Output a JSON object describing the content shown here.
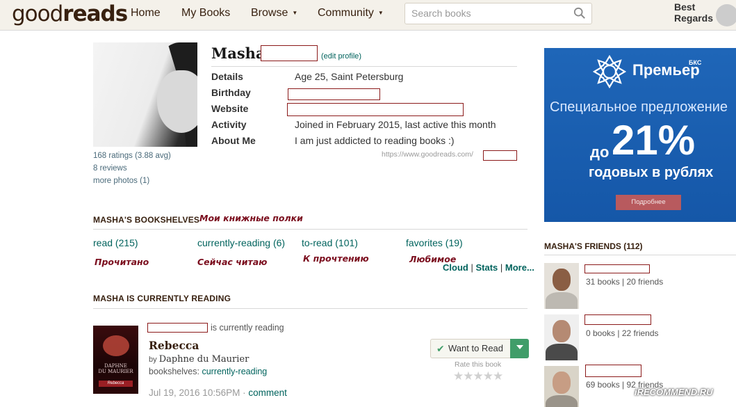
{
  "header": {
    "logo_light": "good",
    "logo_bold": "reads",
    "nav": [
      "Home",
      "My Books",
      "Browse",
      "Community"
    ],
    "search_placeholder": "Search books",
    "greeting": "Best Regards"
  },
  "profile": {
    "name": "Masha",
    "edit_link": "(edit profile)",
    "stats": [
      "168 ratings (3.88 avg)",
      "8 reviews",
      "more photos (1)"
    ],
    "details": [
      {
        "label": "Details",
        "value": "Age 25, Saint Petersburg"
      },
      {
        "label": "Birthday",
        "value": ""
      },
      {
        "label": "Website",
        "value": ""
      },
      {
        "label": "Activity",
        "value": "Joined in February 2015, last active this month"
      },
      {
        "label": "About Me",
        "value": "I am just addicted to reading books :)"
      }
    ],
    "url": "https://www.goodreads.com/"
  },
  "bookshelves": {
    "title": "MASHA'S BOOKSHELVES",
    "annotation": "Мои книжные полки",
    "shelves": [
      {
        "label": "read (215)",
        "annotation": "Прочитано"
      },
      {
        "label": "currently-reading (6)",
        "annotation": "Сейчас читаю"
      },
      {
        "label": "to-read (101)",
        "annotation": "К прочтению"
      },
      {
        "label": "favorites (19)",
        "annotation": "Любимое"
      }
    ],
    "links": [
      "Cloud",
      "Stats",
      "More..."
    ]
  },
  "current_reading": {
    "title": "MASHA IS CURRENTLY READING",
    "status": "is currently reading",
    "book_title": "Rebecca",
    "by": "by",
    "author": "Daphne du Maurier",
    "shelves_label": "bookshelves:",
    "shelves_value": "currently-reading",
    "date": "Jul 19, 2016 10:56PM",
    "dot": "·",
    "comment": "comment",
    "want_to_read": "Want to Read",
    "rate_label": "Rate this book",
    "stars": "★★★★★",
    "cover_author_1": "DAPHNE",
    "cover_author_2": "DU MAURIER",
    "cover_title": "Rebecca"
  },
  "ad": {
    "brand": "Премьер",
    "bks": "БКС",
    "special": "Специальное предложение",
    "do": "до",
    "pct": "21%",
    "rub": "годовых в рублях",
    "button": "Подробнее"
  },
  "friends": {
    "title": "MASHA'S FRIENDS (112)",
    "items": [
      {
        "meta": "31 books | 20 friends"
      },
      {
        "meta": "0 books | 22 friends"
      },
      {
        "meta": "69 books | 92 friends"
      }
    ]
  },
  "watermark": "iRECOMMEND.RU"
}
